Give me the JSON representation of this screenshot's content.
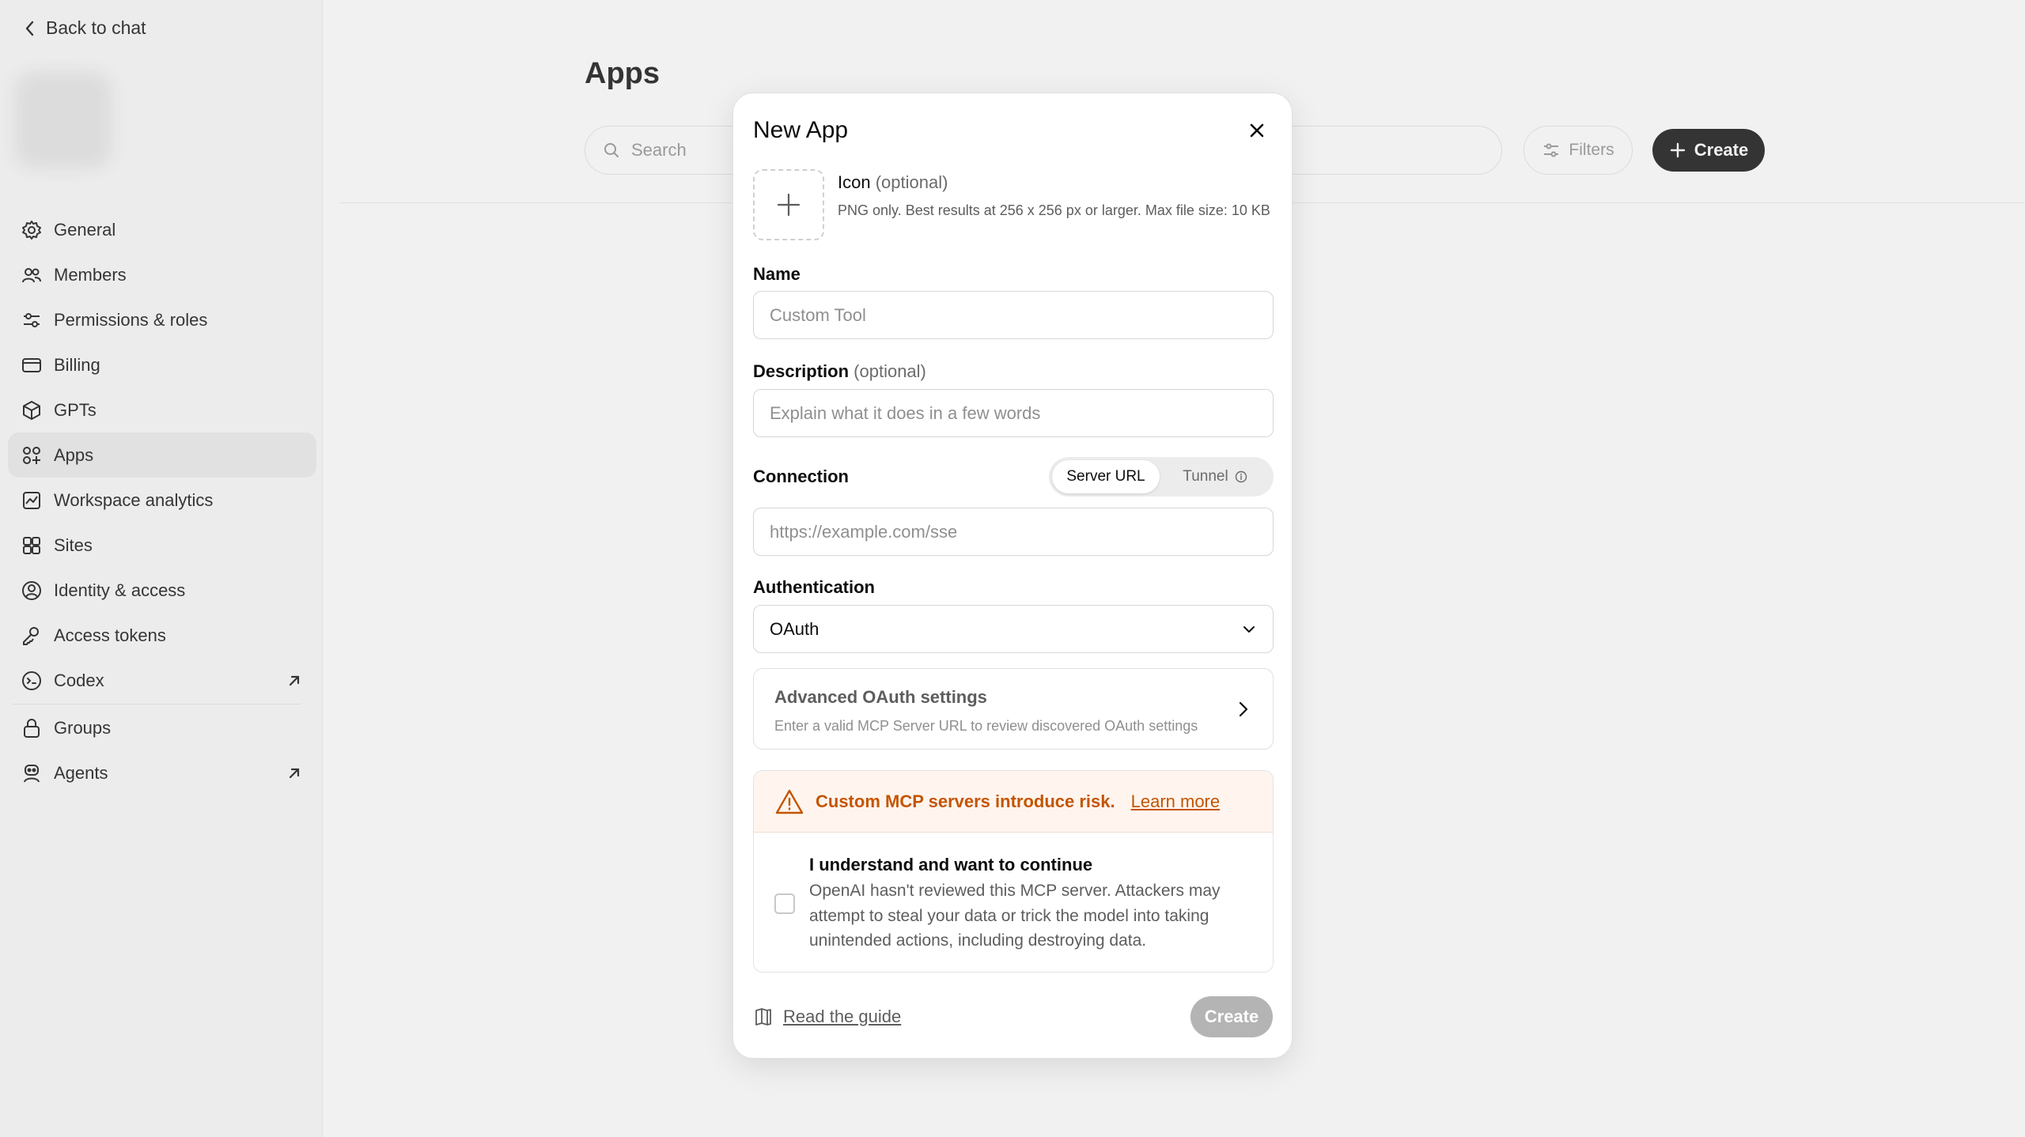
{
  "sidebar": {
    "back_label": "Back to chat",
    "items": [
      {
        "label": "General",
        "icon": "gear-icon"
      },
      {
        "label": "Members",
        "icon": "users-icon"
      },
      {
        "label": "Permissions & roles",
        "icon": "sliders-icon"
      },
      {
        "label": "Billing",
        "icon": "credit-card-icon"
      },
      {
        "label": "GPTs",
        "icon": "cube-icon"
      },
      {
        "label": "Apps",
        "icon": "apps-icon",
        "active": true
      },
      {
        "label": "Workspace analytics",
        "icon": "analytics-icon"
      },
      {
        "label": "Sites",
        "icon": "sites-icon"
      },
      {
        "label": "Identity & access",
        "icon": "identity-icon"
      },
      {
        "label": "Access tokens",
        "icon": "token-icon"
      },
      {
        "label": "Codex",
        "icon": "terminal-icon",
        "external": true
      },
      {
        "label": "Groups",
        "icon": "lock-icon"
      },
      {
        "label": "Agents",
        "icon": "agent-icon",
        "external": true
      }
    ]
  },
  "main": {
    "title": "Apps",
    "search_placeholder": "Search",
    "filters_label": "Filters",
    "create_label": "Create"
  },
  "modal": {
    "title": "New App",
    "icon": {
      "label": "Icon",
      "optional": "(optional)",
      "help": "PNG only. Best results at 256 x 256 px or larger. Max file size: 10 KB"
    },
    "name": {
      "label": "Name",
      "placeholder": "Custom Tool"
    },
    "description": {
      "label": "Description",
      "optional": "(optional)",
      "placeholder": "Explain what it does in a few words"
    },
    "connection": {
      "label": "Connection",
      "options": [
        "Server URL",
        "Tunnel"
      ],
      "selected": "Server URL",
      "url_placeholder": "https://example.com/sse"
    },
    "authentication": {
      "label": "Authentication",
      "selected": "OAuth"
    },
    "advanced": {
      "title": "Advanced OAuth settings",
      "subtitle": "Enter a valid MCP Server URL to review discovered OAuth settings"
    },
    "risk": {
      "warning": "Custom MCP servers introduce risk.",
      "learn_more": "Learn more",
      "ack_label": "I understand and want to continue",
      "ack_desc": "OpenAI hasn't reviewed this MCP server. Attackers may attempt to steal your data or trick the model into taking unintended actions, including destroying data.",
      "checked": false
    },
    "guide_label": "Read the guide",
    "create_label": "Create"
  },
  "colors": {
    "warning": "#c45500",
    "warning_bg": "#fff5ee",
    "disabled_button": "#b4b4b4",
    "active_nav": "#ececec"
  }
}
